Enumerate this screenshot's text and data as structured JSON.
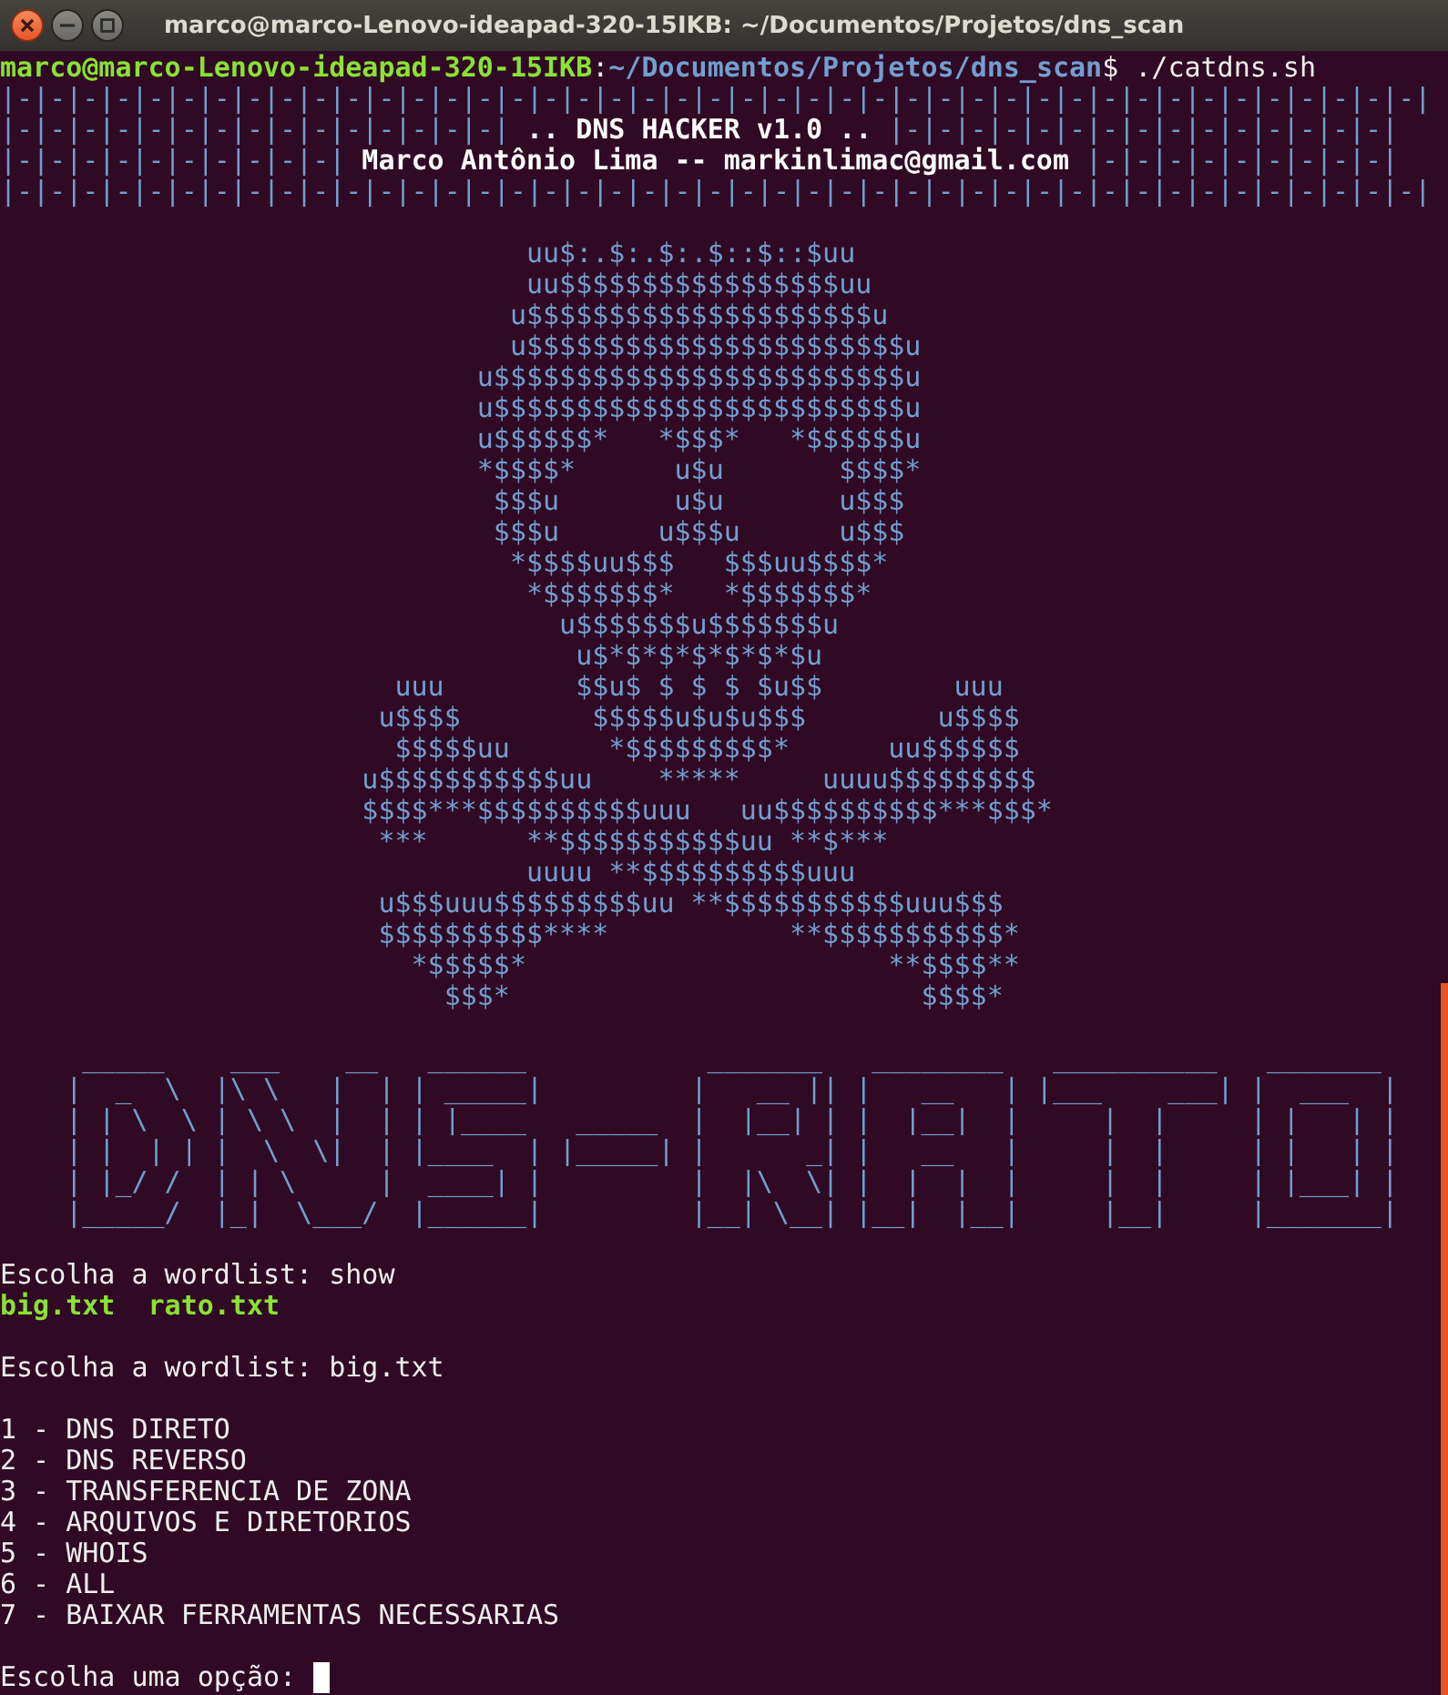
{
  "window": {
    "title": "marco@marco-Lenovo-ideapad-320-15IKB: ~/Documentos/Projetos/dns_scan"
  },
  "terminal": {
    "cursor": true,
    "blocks": [
      {
        "kind": "text",
        "lines": [
          [
            {
              "kind": "user",
              "text": "marco@marco-Lenovo-ideapad-320-15IKB"
            },
            {
              "kind": "plain",
              "text": ":"
            },
            {
              "kind": "path",
              "text": "~/Documentos/Projetos/dns_scan"
            },
            {
              "kind": "plain",
              "text": "$ ./catdns.sh"
            }
          ],
          [
            {
              "kind": "border",
              "text": "|-|-|-|-|-|-|-|-|-|-|-|-|-|-|-|-|-|-|-|-|-|-|-|-|-|-|-|-|-|-|-|-|-|-|-|-|-|-|-|-|-|-|-|"
            }
          ],
          [
            {
              "kind": "border",
              "text": "|-|-|-|-|-|-|-|-|-|-|-|-|-|-|-|"
            },
            {
              "kind": "bold",
              "text": ".. DNS HACKER v1.0 .."
            },
            {
              "kind": "border",
              "text": "|-|-|-|-|-|-|-|-|-|-|-|-|-|-|-|"
            }
          ],
          [
            {
              "kind": "border",
              "text": "|-|-|-|-|-|-|-|-|-|-|"
            },
            {
              "kind": "bold",
              "text": "Marco Antônio Lima -- markinlimac@gmail.com"
            },
            {
              "kind": "border",
              "text": "|-|-|-|-|-|-|-|-|-|"
            }
          ],
          [
            {
              "kind": "border",
              "text": "|-|-|-|-|-|-|-|-|-|-|-|-|-|-|-|-|-|-|-|-|-|-|-|-|-|-|-|-|-|-|-|-|-|-|-|-|-|-|-|-|-|-|-|"
            }
          ]
        ]
      },
      {
        "kind": "skull",
        "lines": [
          "          uu$:.$:.$:.$::$::$uu",
          "          uu$$$$$$$$$$$$$$$$$uu",
          "         u$$$$$$$$$$$$$$$$$$$$$u",
          "         u$$$$$$$$$$$$$$$$$$$$$$$u",
          "       u$$$$$$$$$$$$$$$$$$$$$$$$$u",
          "       u$$$$$$$$$$$$$$$$$$$$$$$$$u",
          "       u$$$$$$*   *$$$*   *$$$$$$u",
          "       *$$$$*      u$u       $$$$*",
          "        $$$u       u$u       u$$$",
          "        $$$u      u$$$u      u$$$",
          "         *$$$$uu$$$   $$$uu$$$$*",
          "          *$$$$$$$*   *$$$$$$$*",
          "            u$$$$$$$u$$$$$$$u",
          "             u$*$*$*$*$*$*$u",
          "  uuu        $$u$ $ $ $ $u$$        uuu",
          " u$$$$        $$$$$u$u$u$$$        u$$$$",
          "  $$$$$uu      *$$$$$$$$$*      uu$$$$$$",
          "u$$$$$$$$$$$uu    *****     uuuu$$$$$$$$$",
          "$$$$***$$$$$$$$$$uuu   uu$$$$$$$$$$***$$$*",
          " ***      **$$$$$$$$$$$uu **$***",
          "          uuuu **$$$$$$$$$$uuu",
          " u$$$uuu$$$$$$$$$uu **$$$$$$$$$$$uuu$$$",
          " $$$$$$$$$$****           **$$$$$$$$$$$*",
          "   *$$$$$*                      **$$$$**",
          "     $$$*                         $$$$*"
        ]
      },
      {
        "kind": "logo",
        "lines": [
          " _____    ___    __   ______           _______   ________   __________   _______",
          "|  _  \\  |\\ \\   |  | | _____|         |   __ || |   __   | |___    ___| |  ___  |",
          "| | \\  \\ | \\ \\  |  | | |____   _____  |  |__| | |  |__|  |     |  |     | |   | |",
          "| |  | | |  \\  \\|  | |____  | |_____| |      _| |   __   |     |  |     | |   | |",
          "| |_/ /  | | \\     |  ____| |         |  |\\  \\| |  |  |  |     |  |     | |___| |",
          "|_____/  |_|  \\___/  |______|         |__| \\__| |__|  |__|     |__|     |_______|"
        ]
      },
      {
        "kind": "text",
        "lines": [
          [
            {
              "kind": "plain",
              "text": "Escolha a wordlist: show"
            }
          ],
          [
            {
              "kind": "file",
              "text": "big.txt"
            },
            {
              "kind": "file",
              "text": "rato.txt"
            }
          ]
        ]
      },
      {
        "kind": "text",
        "lines": [
          [
            {
              "kind": "plain",
              "text": "Escolha a wordlist: big.txt"
            }
          ]
        ]
      },
      {
        "kind": "text",
        "lines": [
          [
            {
              "kind": "plain",
              "text": "1 - DNS DIRETO"
            }
          ],
          [
            {
              "kind": "plain",
              "text": "2 - DNS REVERSO"
            }
          ],
          [
            {
              "kind": "plain",
              "text": "3 - TRANSFERENCIA DE ZONA"
            }
          ],
          [
            {
              "kind": "plain",
              "text": "4 - ARQUIVOS E DIRETORIOS"
            }
          ],
          [
            {
              "kind": "plain",
              "text": "5 - WHOIS"
            }
          ],
          [
            {
              "kind": "plain",
              "text": "6 - ALL"
            }
          ],
          [
            {
              "kind": "plain",
              "text": "7 - BAIXAR FERRAMENTAS NECESSARIAS"
            }
          ]
        ]
      },
      {
        "kind": "text",
        "lines": [
          [
            {
              "kind": "plain",
              "text": "Escolha uma opção:"
            }
          ]
        ]
      }
    ]
  }
}
